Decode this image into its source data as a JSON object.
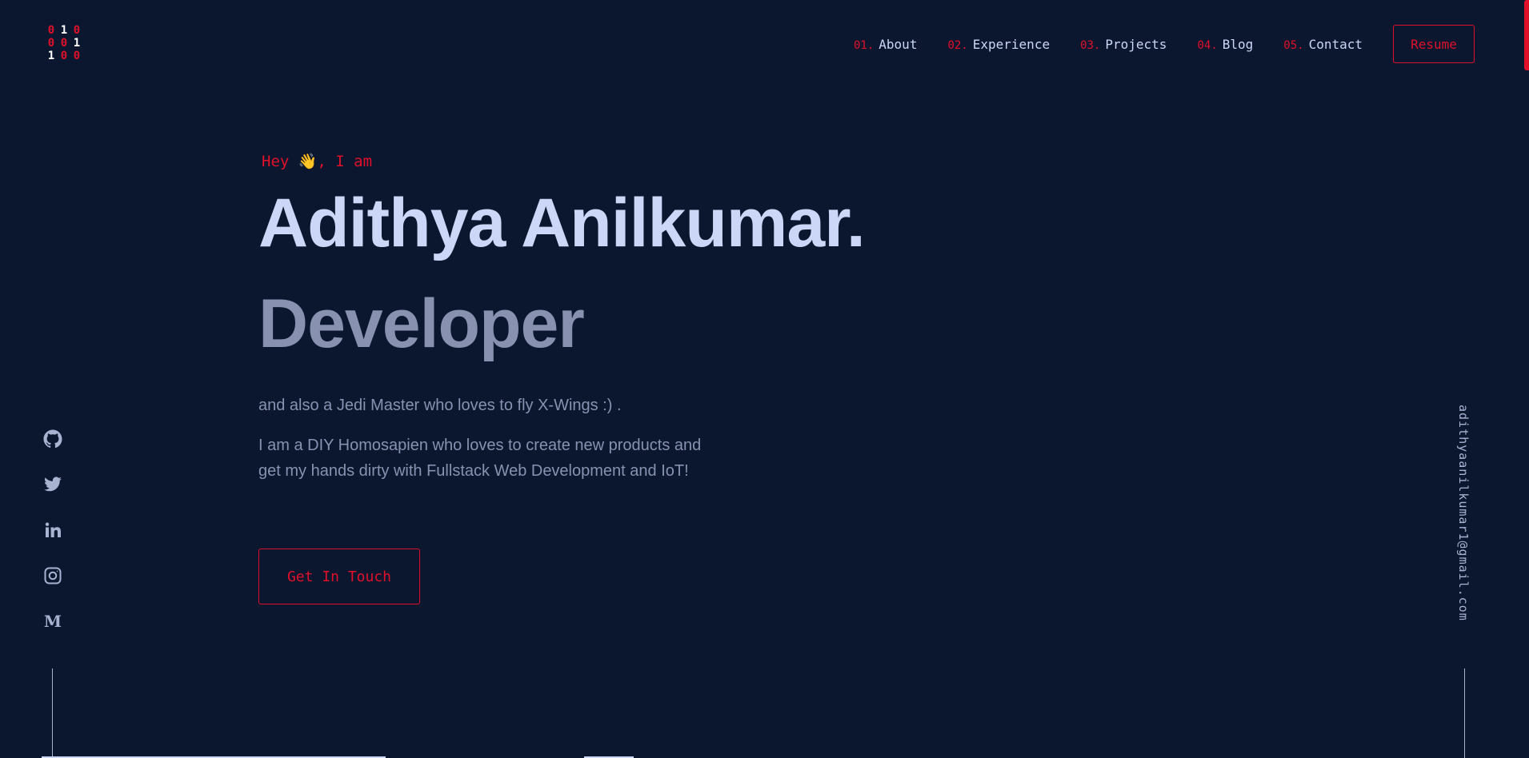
{
  "logo": {
    "label": "010 001 100 logo",
    "rows": [
      [
        "0",
        "1",
        "0"
      ],
      [
        "0",
        "0",
        "1"
      ],
      [
        "1",
        "0",
        "0"
      ]
    ]
  },
  "nav": {
    "items": [
      {
        "num": "01.",
        "label": "About"
      },
      {
        "num": "02.",
        "label": "Experience"
      },
      {
        "num": "03.",
        "label": "Projects"
      },
      {
        "num": "04.",
        "label": "Blog"
      },
      {
        "num": "05.",
        "label": "Contact"
      }
    ],
    "resume_label": "Resume"
  },
  "hero": {
    "greeting": "Hey 👋, I am",
    "name": "Adithya Anilkumar.",
    "role": "Developer",
    "tagline": "and also a Jedi Master who loves to fly X-Wings :) .",
    "description_line1": "I am a DIY Homosapien who loves to create new products and",
    "description_line2": "get my hands dirty with Fullstack Web Development and IoT!",
    "cta_label": "Get In Touch"
  },
  "socials": {
    "icons": [
      "github-icon",
      "twitter-icon",
      "linkedin-icon",
      "instagram-icon",
      "medium-icon"
    ]
  },
  "email": "adithyaanilkumar1@gmail.com",
  "colors": {
    "background": "#0b172f",
    "accent": "#e0102b",
    "heading": "#ccd6f6",
    "muted": "#8892b0"
  }
}
